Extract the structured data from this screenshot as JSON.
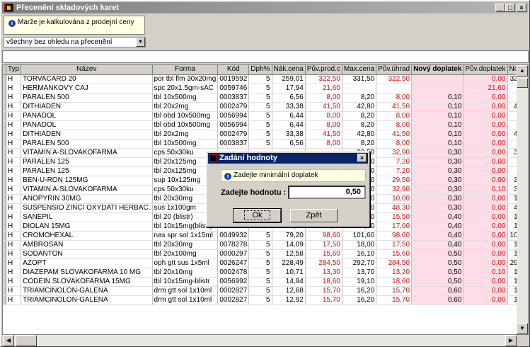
{
  "window": {
    "title": "Přecenění skladových karet"
  },
  "info_text": "Marže je kalkulována z prodejní ceny",
  "filter": {
    "selected": "všechny bez ohledu na přecenění"
  },
  "table": {
    "columns": [
      "Typ",
      "Název",
      "Forma",
      "Kód",
      "Dph%",
      "Nák.cena",
      "Pův.prod.c",
      "Max.cena",
      "Pův.úhrad",
      "Nový doplatek",
      "Pův.doplatek",
      "Nová p"
    ],
    "rows": [
      [
        "H",
        "TORVACARD 20",
        "por tbl flm 30x20mg",
        "0019592",
        "5",
        "259,01",
        "322,50",
        "331,50",
        "322,50",
        "",
        "0,00",
        "322,50"
      ],
      [
        "H",
        "HEŘMÁNKOVÝ ČAJ",
        "spc 20x1.5gm-sÁČ",
        "0059746",
        "5",
        "17,94",
        "21,60",
        "",
        "",
        "",
        "21,60",
        "0,00"
      ],
      [
        "H",
        "PARALEN 500",
        "tbl 10x500mg",
        "0003837",
        "5",
        "6,56",
        "8,00",
        "8,20",
        "8,00",
        "0,10",
        "0,00",
        "8,14"
      ],
      [
        "H",
        "DITHIADEN",
        "tbl 20x2mg",
        "0002479",
        "5",
        "33,38",
        "41,50",
        "42,80",
        "41,50",
        "0,10",
        "0,00",
        "42,80"
      ],
      [
        "H",
        "PANADOL",
        "tbl obd 10x500mg",
        "0056994",
        "5",
        "6,44",
        "8,00",
        "8,20",
        "8,00",
        "0,10",
        "0,00",
        "8,14"
      ],
      [
        "H",
        "PANADOL",
        "tbl obd 10x500mg",
        "0056994",
        "5",
        "6,44",
        "8,00",
        "8,20",
        "8,00",
        "0,10",
        "0,00",
        "8,14"
      ],
      [
        "H",
        "DITHIADEN",
        "tbl 20x2mg",
        "0002479",
        "5",
        "33,38",
        "41,50",
        "42,80",
        "41,50",
        "0,10",
        "0,00",
        "42,80"
      ],
      [
        "H",
        "PARALEN 500",
        "tbl 10x500mg",
        "0003837",
        "5",
        "6,56",
        "8,00",
        "8,20",
        "8,00",
        "0,10",
        "0,00",
        "8,14"
      ],
      [
        "H",
        "VITAMIN A-SLOVAKOFARMA",
        "cps 50x30ku",
        "",
        "",
        "",
        "",
        "33,50",
        "32,90",
        "0,30",
        "0,00",
        "32,90"
      ],
      [
        "H",
        "PARALEN 125",
        "tbl 20x125mg",
        "",
        "",
        "",
        "",
        "7,30",
        "7,20",
        "0,30",
        "0,00",
        "7,23"
      ],
      [
        "H",
        "PARALEN 125",
        "tbl 20x125mg",
        "",
        "",
        "",
        "",
        "7,30",
        "7,20",
        "0,30",
        "0,00",
        "7,23"
      ],
      [
        "H",
        "BEN-U-RON 125MG",
        "sup 10x125mg",
        "",
        "",
        "",
        "",
        "30,40",
        "29,50",
        "0,30",
        "0,00",
        "30,38"
      ],
      [
        "H",
        "VITAMIN A-SLOVAKOFARMA",
        "cps 50x30ku",
        "",
        "",
        "",
        "",
        "33,10",
        "32,90",
        "0,30",
        "0,10",
        "33,00"
      ],
      [
        "H",
        "ANOPYRIN 30MG",
        "tbl 20x30mg",
        "",
        "",
        "",
        "",
        "10,30",
        "10,00",
        "0,30",
        "0,00",
        "10,30"
      ],
      [
        "H",
        "SUSPENSIO ZINCI OXYDATI HERBAC.",
        "sus 1x100gm",
        "",
        "",
        "",
        "",
        "50,80",
        "48,30",
        "0,30",
        "0,00",
        "49,73"
      ],
      [
        "H",
        "SANEPIL",
        "tbl 20 (blistr)",
        "0002625",
        "5",
        "12,50",
        "15,50",
        "16,00",
        "15,50",
        "0,40",
        "0,00",
        "15,96"
      ],
      [
        "H",
        "DIOLAN 15MG",
        "tbl 10x15mg(blistr)",
        "0044590",
        "5",
        "14,42",
        "17,60",
        "18,10",
        "17,60",
        "0,40",
        "0,00",
        "18,02"
      ],
      [
        "H",
        "CROMOHEXAL",
        "nas spr sol 1x15ml",
        "0049932",
        "5",
        "79,20",
        "98,60",
        "101,60",
        "98,60",
        "0,40",
        "0,00",
        "101,56"
      ],
      [
        "H",
        "AMBROSAN",
        "tbl 20x30mg",
        "0078278",
        "5",
        "14,09",
        "17,50",
        "18,00",
        "17,50",
        "0,40",
        "0,00",
        "17,61"
      ],
      [
        "H",
        "SODANTON",
        "tbl 20x100mg",
        "0000297",
        "5",
        "12,58",
        "15,60",
        "16,10",
        "15,60",
        "0,50",
        "0,00",
        "16,10"
      ],
      [
        "H",
        "AZOPT",
        "oph gtt sus 1x5ml",
        "0026247",
        "5",
        "228,49",
        "284,50",
        "292,70",
        "284,50",
        "0,50",
        "0,00",
        "292,70"
      ],
      [
        "H",
        "DIAZEPAM SLOVAKOFARMA 10 MG",
        "tbl 20x10mg",
        "0002478",
        "5",
        "10,71",
        "13,30",
        "13,70",
        "13,20",
        "0,50",
        "0,10",
        "13,70"
      ],
      [
        "H",
        "CODEIN SLOVAKOFARMA 15MG",
        "tbl 10x15mg-blistr",
        "0056992",
        "5",
        "14,94",
        "18,60",
        "19,10",
        "18,60",
        "0,50",
        "0,00",
        "19,10"
      ],
      [
        "H",
        "TRIAMCINOLON-GALENA",
        "drm gtt sol 1x10ml",
        "0002827",
        "5",
        "12,68",
        "15,70",
        "16,20",
        "15,70",
        "0,60",
        "0,00",
        "16,20"
      ],
      [
        "H",
        "TRIAMCINOLON-GALENA",
        "drm gtt sol 1x10ml",
        "0002827",
        "5",
        "12,92",
        "15,70",
        "16,20",
        "15,70",
        "0,60",
        "0,00",
        "16,20"
      ]
    ]
  },
  "dialog": {
    "title": "Zadání hodnoty",
    "info": "Zadejte minimální doplatek",
    "label": "Zadejte hodnotu :",
    "value": "0,50",
    "ok": "Ok",
    "back": "Zpět"
  }
}
